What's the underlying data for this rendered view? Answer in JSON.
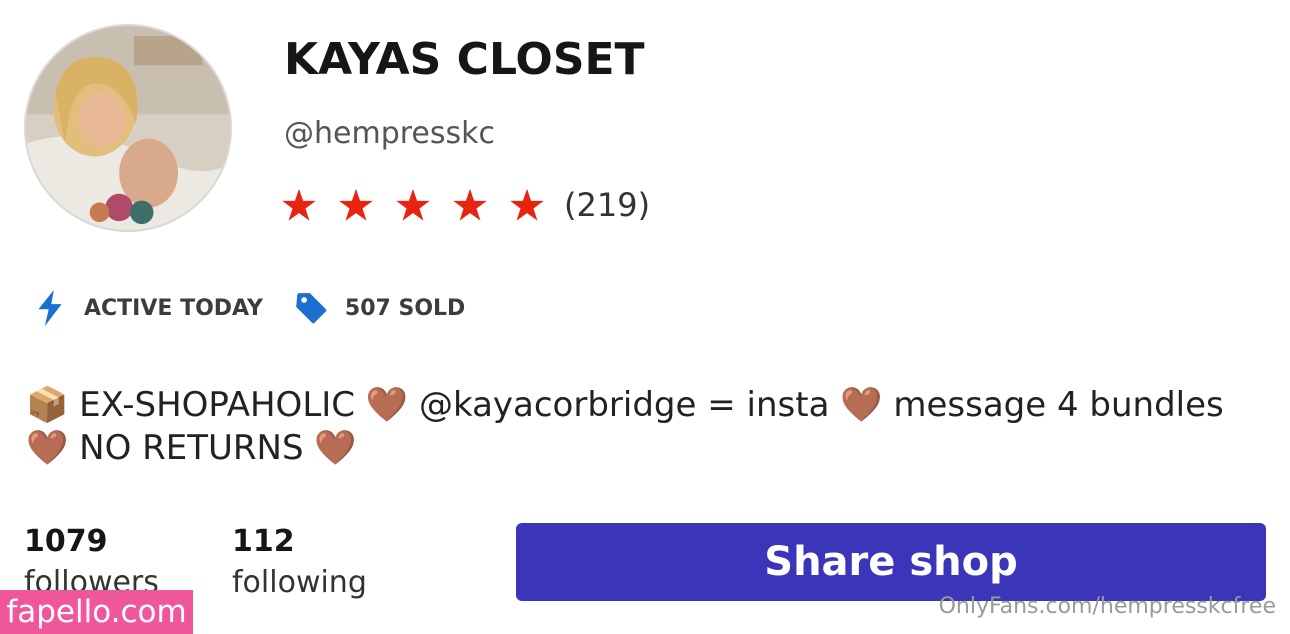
{
  "profile": {
    "shop_name": "KAYAS CLOSET",
    "handle": "@hempresskc",
    "rating_stars": 5,
    "rating_count": "(219)",
    "accent_star_color": "#e8230f"
  },
  "badges": [
    {
      "icon": "lightning-bolt-icon",
      "label": "ACTIVE TODAY",
      "color": "#1a6fd1"
    },
    {
      "icon": "price-tag-icon",
      "label": "507 SOLD",
      "color": "#1a6fd1"
    }
  ],
  "bio": {
    "line": "📦 EX-SHOPAHOLIC 🤎 @kayacorbridge = insta 🤎 message 4 bundles 🤎 NO RETURNS 🤎"
  },
  "stats": {
    "followers_count": "1079",
    "followers_label": "followers",
    "following_count": "112",
    "following_label": "following"
  },
  "actions": {
    "share_label": "Share shop",
    "share_color": "#3a35b9"
  },
  "watermarks": {
    "left": "fapello.com",
    "right": "OnlyFans.com/hempresskcfree"
  }
}
